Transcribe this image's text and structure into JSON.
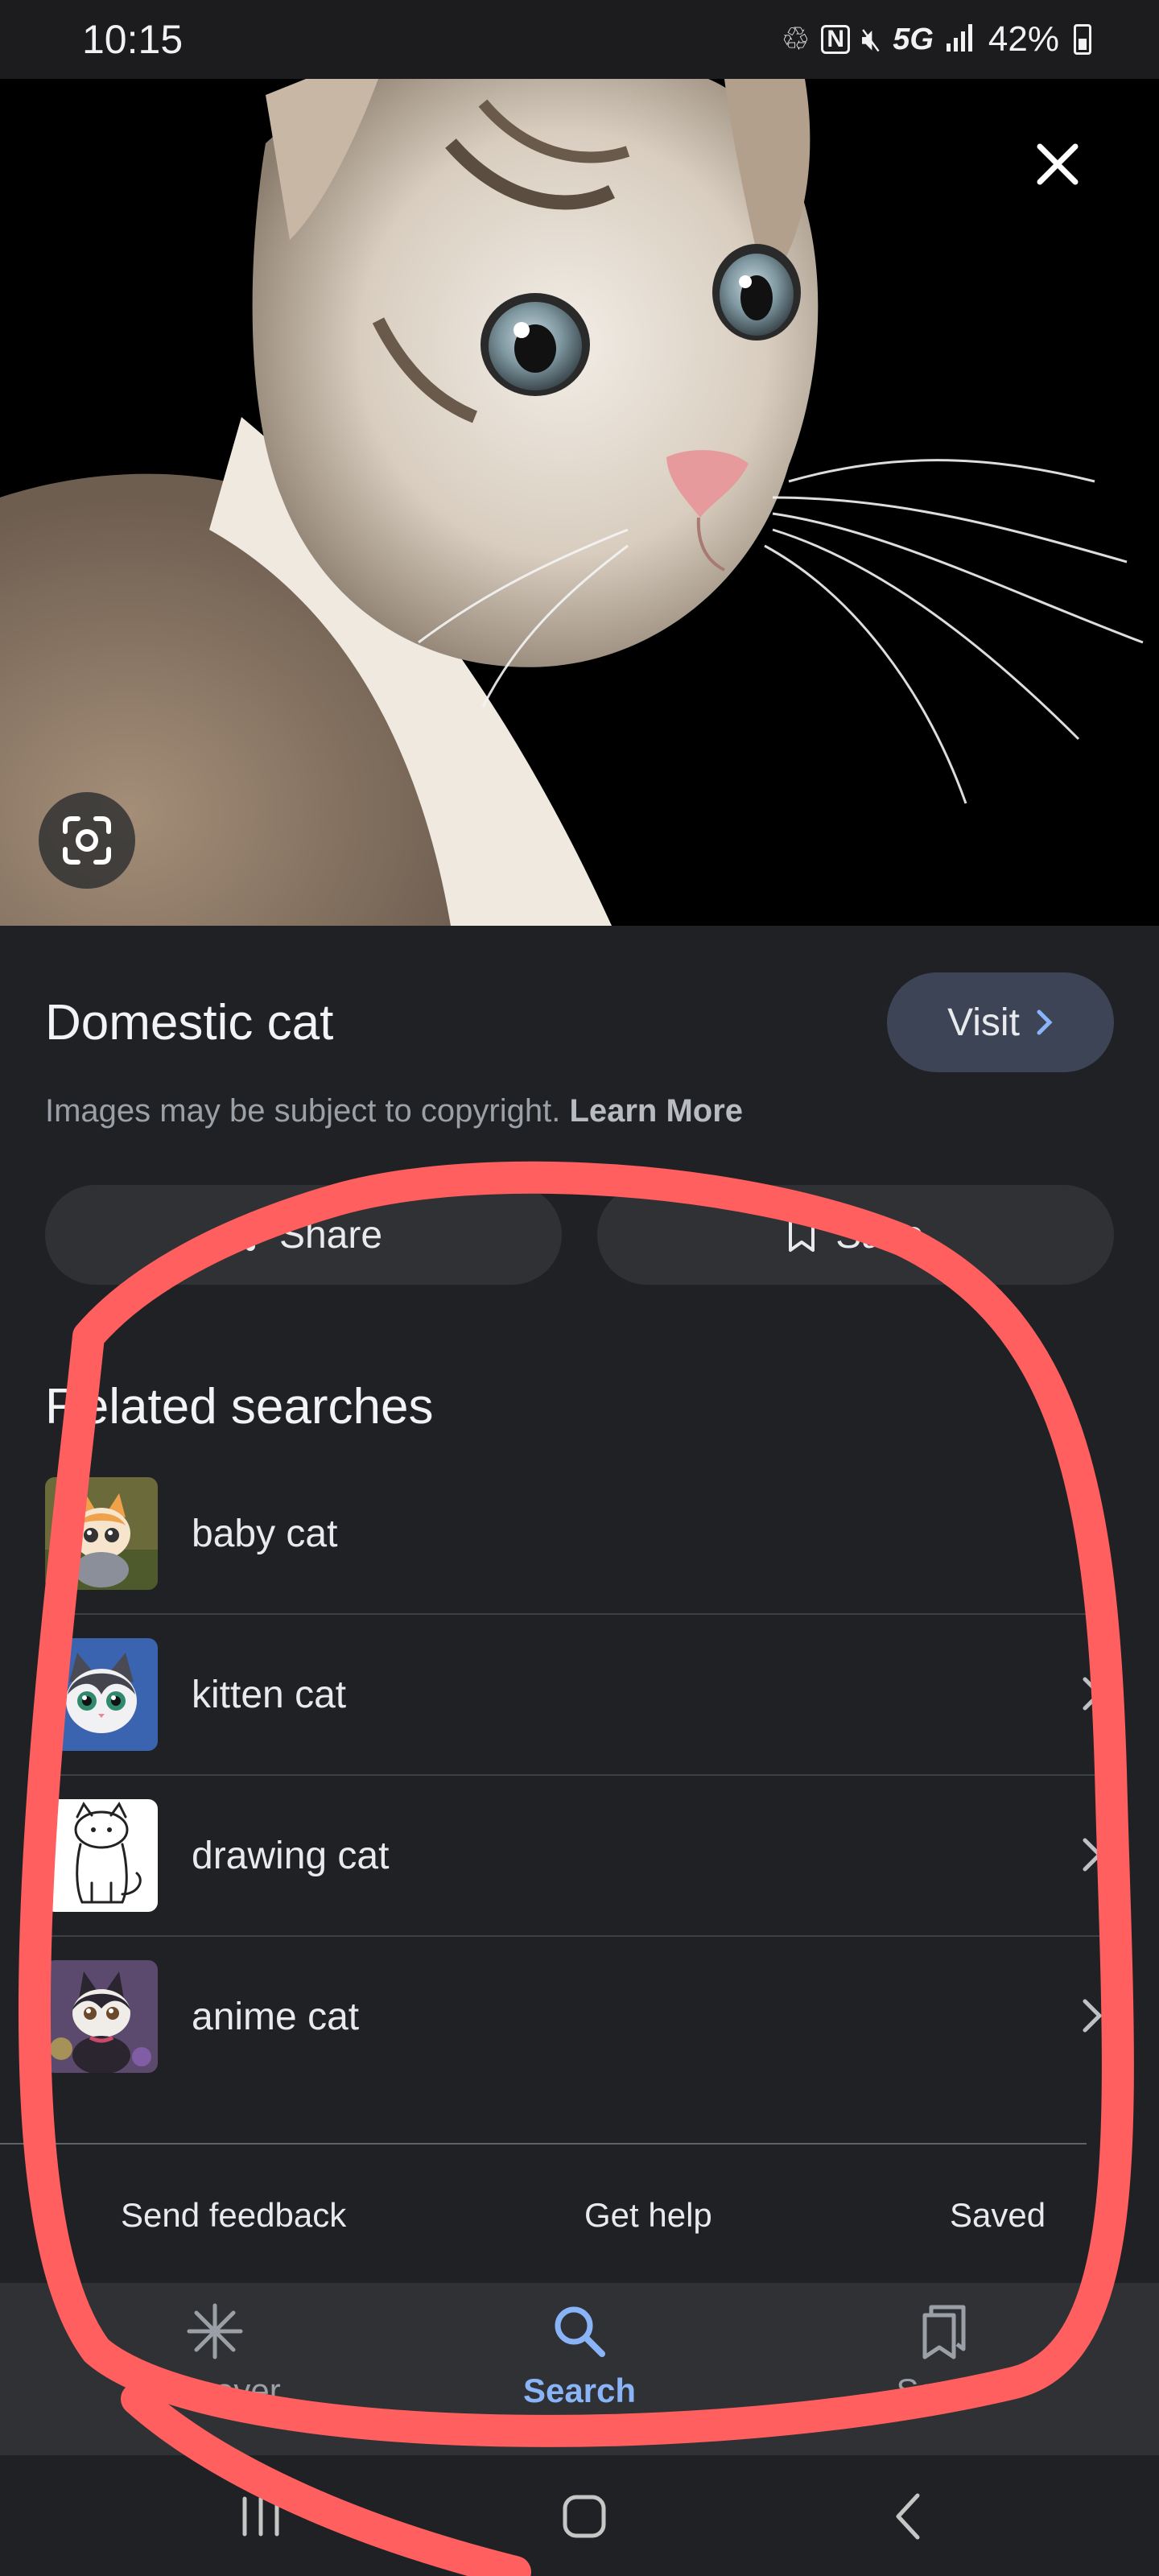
{
  "status_bar": {
    "time": "10:15",
    "network": "5G",
    "battery": "42%",
    "icons": [
      "battery-saver-icon",
      "nfc-icon",
      "mute-icon",
      "signal-icon",
      "battery-icon"
    ]
  },
  "hero": {
    "image": "cat-photo",
    "close_icon": "close-icon",
    "lens_icon": "google-lens-icon"
  },
  "result": {
    "title": "Domestic cat",
    "visit_label": "Visit",
    "copyright_text": "Images may be subject to copyright.",
    "learn_more_label": "Learn More"
  },
  "actions": {
    "share_label": "Share",
    "save_label": "Save"
  },
  "related": {
    "title": "Related searches",
    "items": [
      {
        "label": "baby cat"
      },
      {
        "label": "kitten cat"
      },
      {
        "label": "drawing cat"
      },
      {
        "label": "anime cat"
      }
    ]
  },
  "footer": {
    "send_feedback": "Send feedback",
    "get_help": "Get help",
    "saved": "Saved"
  },
  "bottom_nav": {
    "items": [
      {
        "label": "Discover",
        "icon": "discover-icon",
        "active": false
      },
      {
        "label": "Search",
        "icon": "search-icon",
        "active": true
      },
      {
        "label": "Saved",
        "icon": "saved-icon",
        "active": false
      }
    ]
  },
  "colors": {
    "background": "#202124",
    "accent": "#8ab4f8",
    "annotation": "#ff5f5f"
  }
}
